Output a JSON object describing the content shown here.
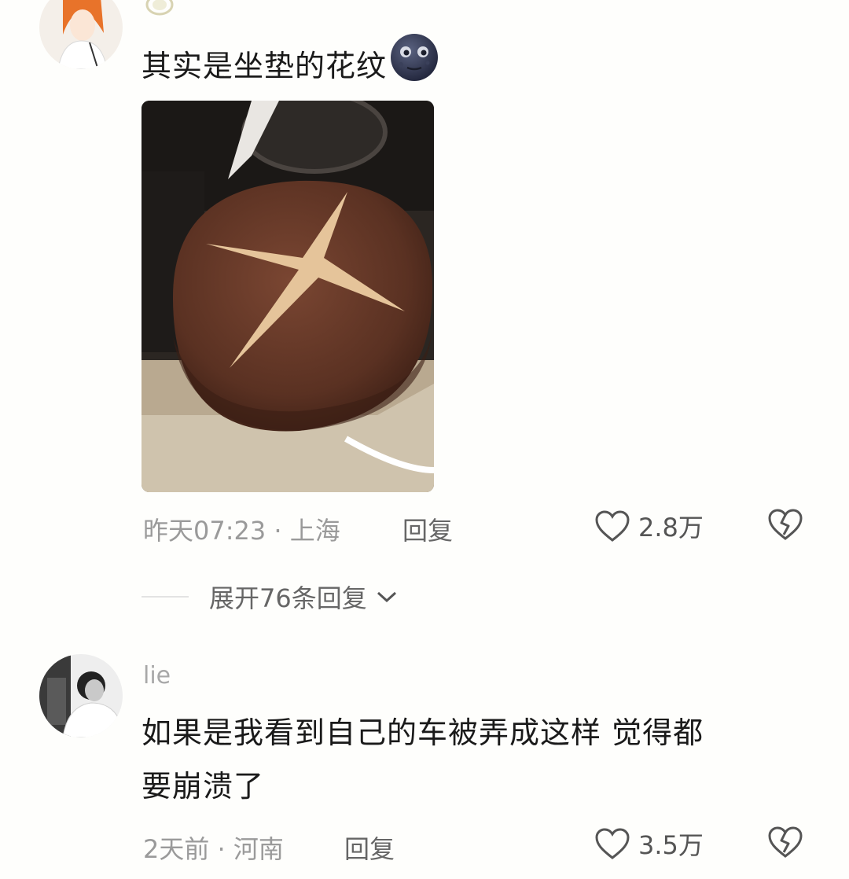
{
  "comments": [
    {
      "text_main": "其实是坐垫的花纹",
      "emoji": "dark-moon-face-emoji",
      "photo": "brown-seat-cushion-with-cross-pattern",
      "time": "昨天07:23 · 上海",
      "reply_label": "回复",
      "like_count": "2.8万",
      "expand_label": "展开76条回复"
    },
    {
      "username": "lie",
      "text_line1": "如果是我看到自己的车被弄成这样 觉得都",
      "text_line2": "要崩溃了",
      "time": "2天前 · 河南",
      "reply_label": "回复",
      "like_count": "3.5万"
    }
  ]
}
